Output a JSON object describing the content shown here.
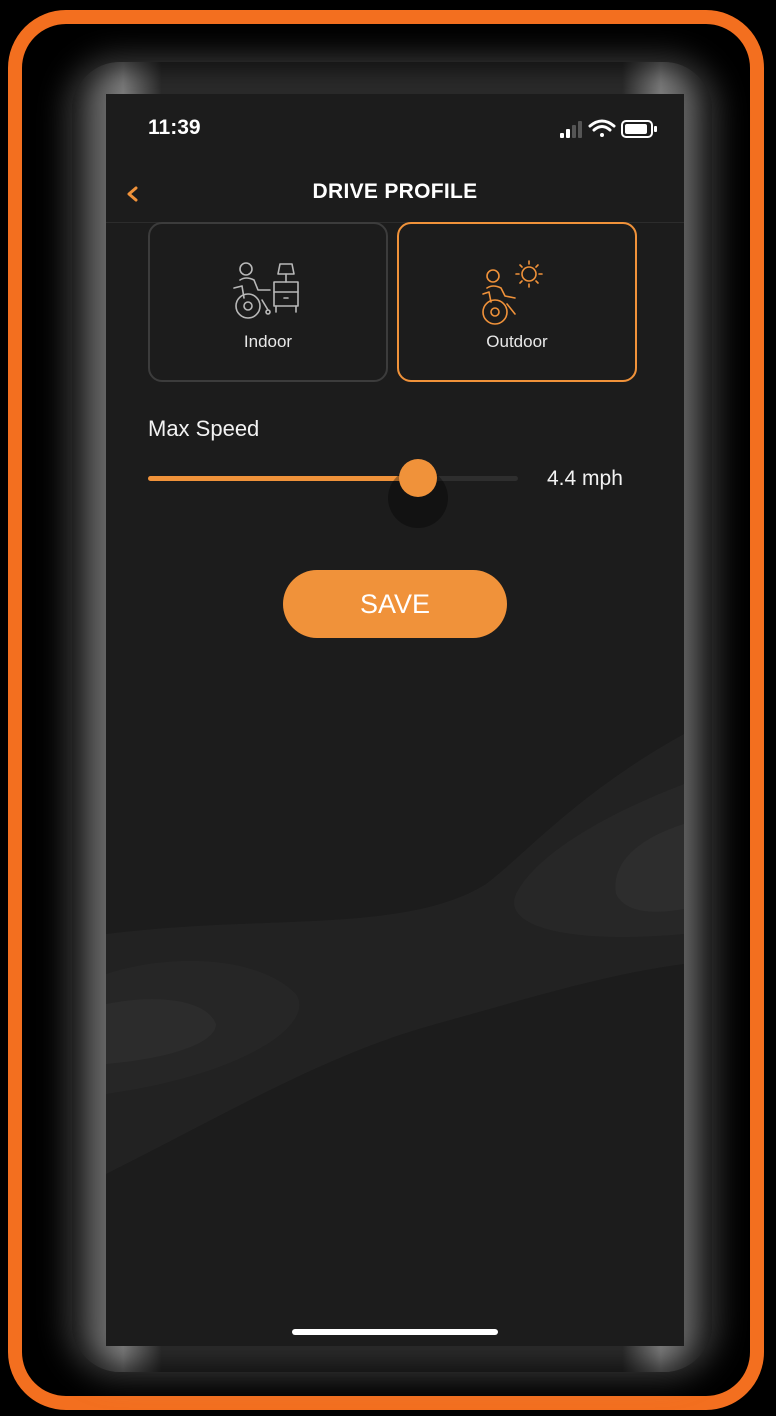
{
  "status_bar": {
    "time": "11:39",
    "icons": [
      "cellular-signal-icon",
      "wifi-icon",
      "battery-icon"
    ]
  },
  "nav": {
    "title": "DRIVE PROFILE",
    "back_icon": "chevron-left-icon"
  },
  "profiles": [
    {
      "label": "Indoor",
      "icon": "wheelchair-indoor-icon",
      "selected": false
    },
    {
      "label": "Outdoor",
      "icon": "wheelchair-outdoor-icon",
      "selected": true
    }
  ],
  "max_speed": {
    "label": "Max Speed",
    "value_text": "4.4 mph",
    "fill_fraction": 0.73
  },
  "save_button": {
    "label": "SAVE"
  },
  "colors": {
    "accent": "#f0923a",
    "device_frame": "#f36f1f",
    "screen_background": "#1c1c1c",
    "text": "#ffffff"
  }
}
